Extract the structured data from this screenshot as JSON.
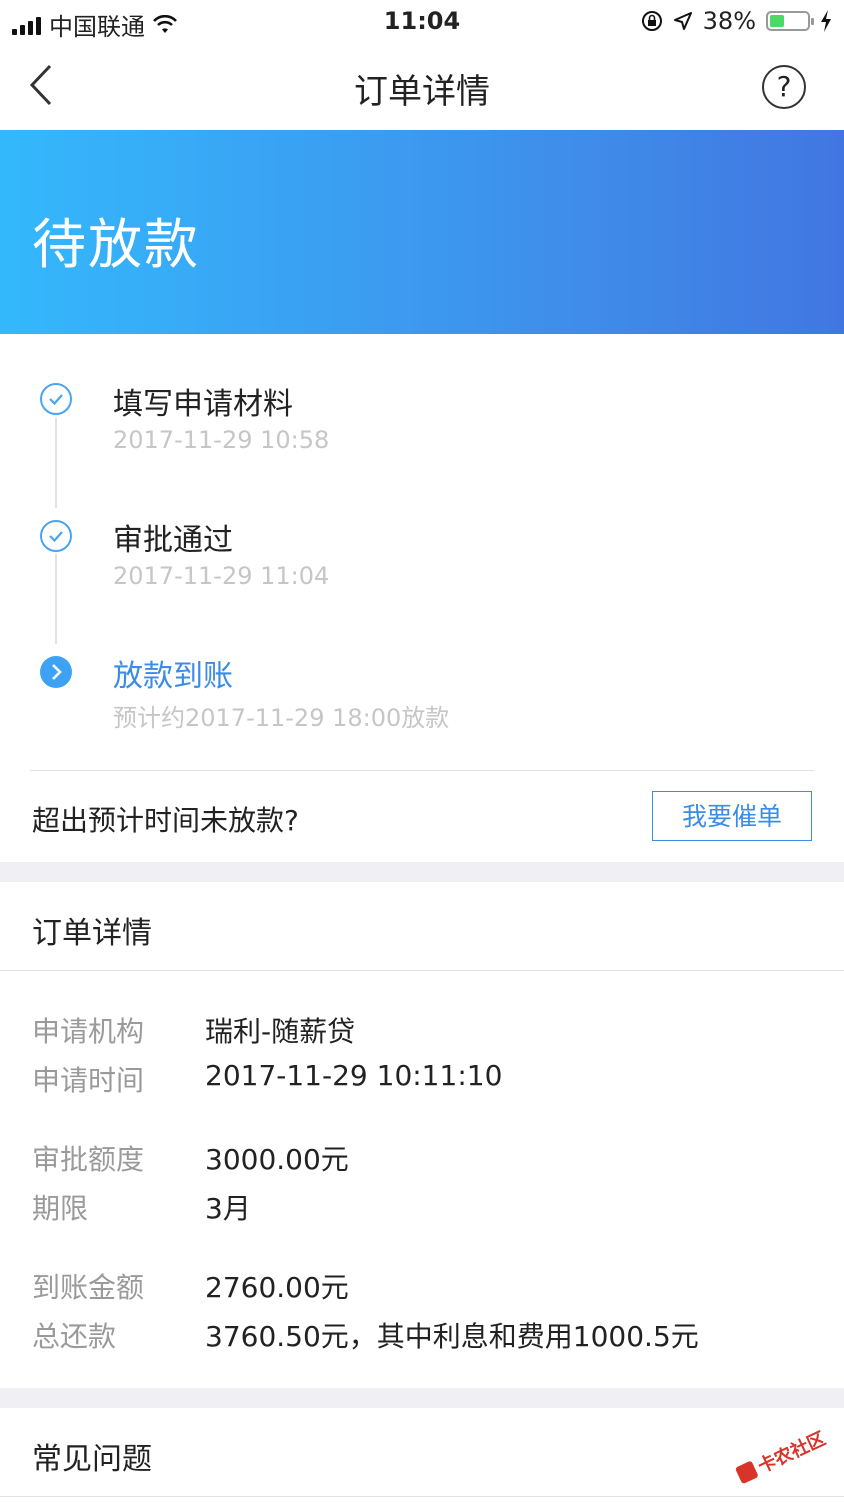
{
  "status_bar": {
    "carrier": "中国联通",
    "time": "11:04",
    "battery_percent": "38%",
    "battery_level": 0.38
  },
  "nav": {
    "title": "订单详情",
    "help_label": "?"
  },
  "banner": {
    "status": "待放款"
  },
  "timeline": {
    "steps": [
      {
        "title": "填写申请材料",
        "time": "2017-11-29 10:58",
        "state": "done"
      },
      {
        "title": "审批通过",
        "time": "2017-11-29 11:04",
        "state": "done"
      },
      {
        "title": "放款到账",
        "time": "预计约2017-11-29 18:00放款",
        "state": "active"
      }
    ]
  },
  "urge": {
    "text": "超出预计时间未放款?",
    "button": "我要催单"
  },
  "order_details": {
    "title": "订单详情",
    "rows": [
      {
        "label": "申请机构",
        "value": "瑞利-随薪贷"
      },
      {
        "label": "申请时间",
        "value": "2017-11-29 10:11:10"
      },
      {
        "label": "审批额度",
        "value": "3000.00元"
      },
      {
        "label": "期限",
        "value": "3月"
      },
      {
        "label": "到账金额",
        "value": "2760.00元"
      },
      {
        "label": "总还款",
        "value": "3760.50元，其中利息和费用1000.5元"
      }
    ]
  },
  "faq": {
    "title": "常见问题"
  },
  "watermark": {
    "text": "卡农社区"
  },
  "colors": {
    "accent": "#3b8ce6",
    "banner_start": "#34b8fc",
    "banner_end": "#4176e2",
    "battery": "#4cd964"
  }
}
